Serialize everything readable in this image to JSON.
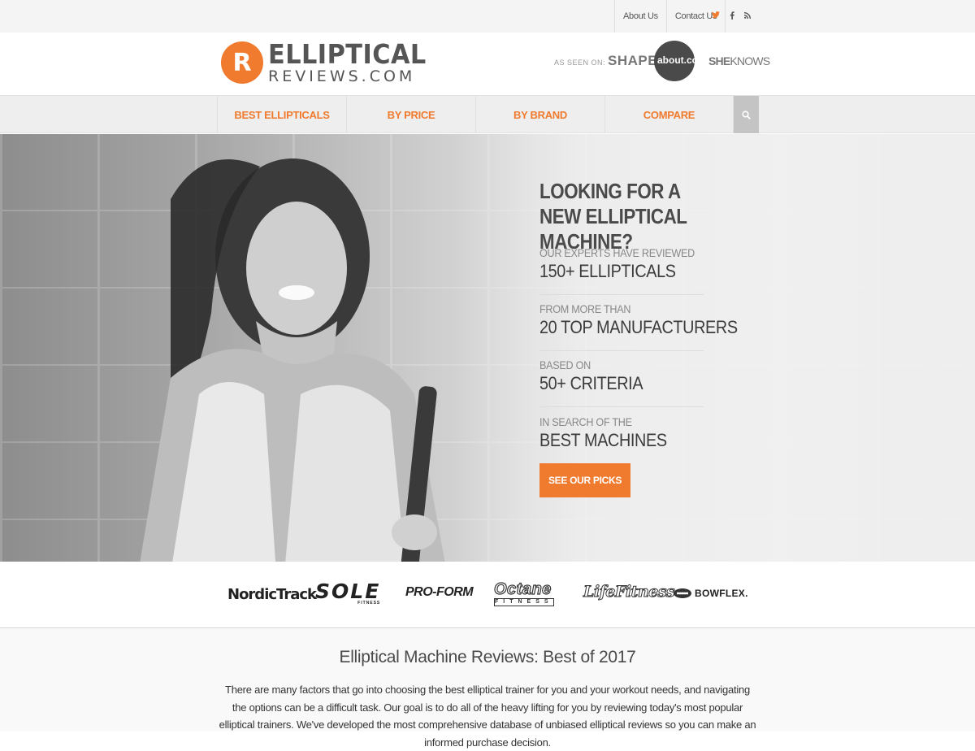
{
  "topbar": {
    "links": [
      "About Us",
      "Contact Us"
    ],
    "social": {
      "twitter": "twitter-icon",
      "facebook": "facebook-icon",
      "rss": "rss-icon"
    }
  },
  "header": {
    "logo_top": "ELLIPTICAL",
    "logo_bottom": "REVIEWS.COM",
    "logo_badge": "R",
    "seen_label": "AS SEEN ON:",
    "press": {
      "shape": "SHAPE",
      "about_main": "about",
      "about_suffix": ".com",
      "sheknows_bold": "SHE",
      "sheknows_light": "KNOWS"
    }
  },
  "nav": {
    "items": [
      "BEST ELLIPTICALS",
      "BY PRICE",
      "BY BRAND",
      "COMPARE"
    ],
    "search_icon": "search-icon"
  },
  "hero": {
    "title": "LOOKING FOR A NEW ELLIPTICAL MACHINE?",
    "stats": [
      {
        "small": "OUR EXPERTS HAVE REVIEWED",
        "big": "150+ ELLIPTICALS"
      },
      {
        "small": "FROM MORE THAN",
        "big": "20 TOP MANUFACTURERS"
      },
      {
        "small": "BASED ON",
        "big": "50+ CRITERIA"
      },
      {
        "small": "IN SEARCH OF THE",
        "big": "BEST MACHINES"
      }
    ],
    "cta": "SEE OUR PICKS"
  },
  "brands": {
    "nordictrack": "NordicTrack",
    "sole": "SOLE",
    "sole_sub": "FITNESS",
    "proform": "PRO-FORM",
    "octane": "Octane",
    "octane_sub": "FITNESS",
    "lifefitness": "LifeFitness",
    "bowflex": "BOWFLEX."
  },
  "intro": {
    "heading": "Elliptical Machine Reviews: Best of 2017",
    "body": "There are many factors that go into choosing the best elliptical trainer for you and your workout needs, and navigating the options can be a difficult task. Our goal is to do all of the heavy lifting for you by reviewing today's most popular elliptical trainers. We've developed the most comprehensive database of unbiased elliptical reviews so you can make an informed purchase decision."
  },
  "colors": {
    "accent": "#f07a2d",
    "nav_bg": "#eeeeee",
    "text_dark": "#4a4a4a"
  }
}
